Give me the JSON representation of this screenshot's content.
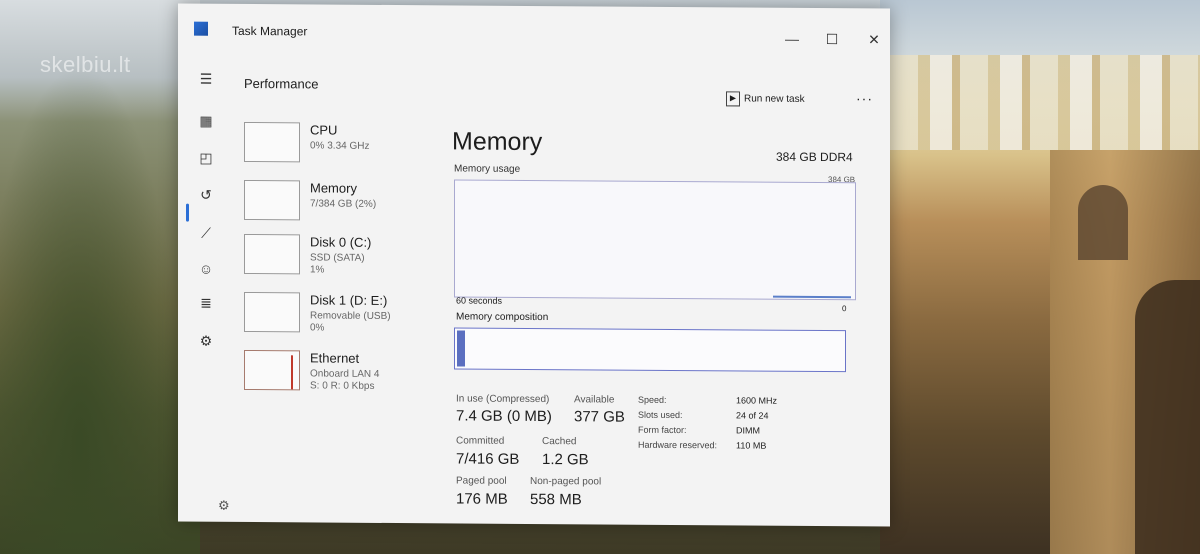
{
  "watermark": "skelbiu.lt",
  "window": {
    "title": "Task Manager",
    "controls": {
      "minimize": "—",
      "maximize": "☐",
      "close": "✕"
    }
  },
  "nav_icons": [
    "hamburger-icon",
    "processes-icon",
    "performance-icon",
    "app-history-icon",
    "startup-icon",
    "users-icon",
    "details-icon",
    "services-icon",
    "settings-icon"
  ],
  "section": {
    "title": "Performance"
  },
  "header_actions": {
    "run_new_task": "Run new task",
    "more": "···"
  },
  "processes": [
    {
      "name": "CPU",
      "sub": "0% 3.34 GHz",
      "sub2": ""
    },
    {
      "name": "Memory",
      "sub": "7/384 GB (2%)",
      "sub2": ""
    },
    {
      "name": "Disk 0 (C:)",
      "sub": "SSD (SATA)",
      "sub2": "1%"
    },
    {
      "name": "Disk 1 (D: E:)",
      "sub": "Removable (USB)",
      "sub2": "0%"
    },
    {
      "name": "Ethernet",
      "sub": "Onboard LAN 4",
      "sub2": "S: 0 R: 0 Kbps"
    }
  ],
  "detail": {
    "title": "Memory",
    "spec": "384 GB DDR4",
    "usage_label": "Memory usage",
    "usage_max": "384 GB",
    "axis_left": "60 seconds",
    "axis_right": "0",
    "composition_label": "Memory composition",
    "composition_in_use_fraction": 0.02,
    "stats": {
      "in_use_label": "In use (Compressed)",
      "in_use_value": "7.4 GB (0 MB)",
      "available_label": "Available",
      "available_value": "377 GB",
      "committed_label": "Committed",
      "committed_value": "7/416 GB",
      "cached_label": "Cached",
      "cached_value": "1.2 GB",
      "paged_label": "Paged pool",
      "paged_value": "176 MB",
      "nonpaged_label": "Non-paged pool",
      "nonpaged_value": "558 MB"
    },
    "specs": [
      {
        "label": "Speed:",
        "value": "1600 MHz"
      },
      {
        "label": "Slots used:",
        "value": "24 of 24"
      },
      {
        "label": "Form factor:",
        "value": "DIMM"
      },
      {
        "label": "Hardware reserved:",
        "value": "110 MB"
      }
    ]
  },
  "colors": {
    "accent": "#2b6fd6",
    "memory_graph": "#5b6fc0",
    "ethernet_spike": "#c0392b"
  }
}
